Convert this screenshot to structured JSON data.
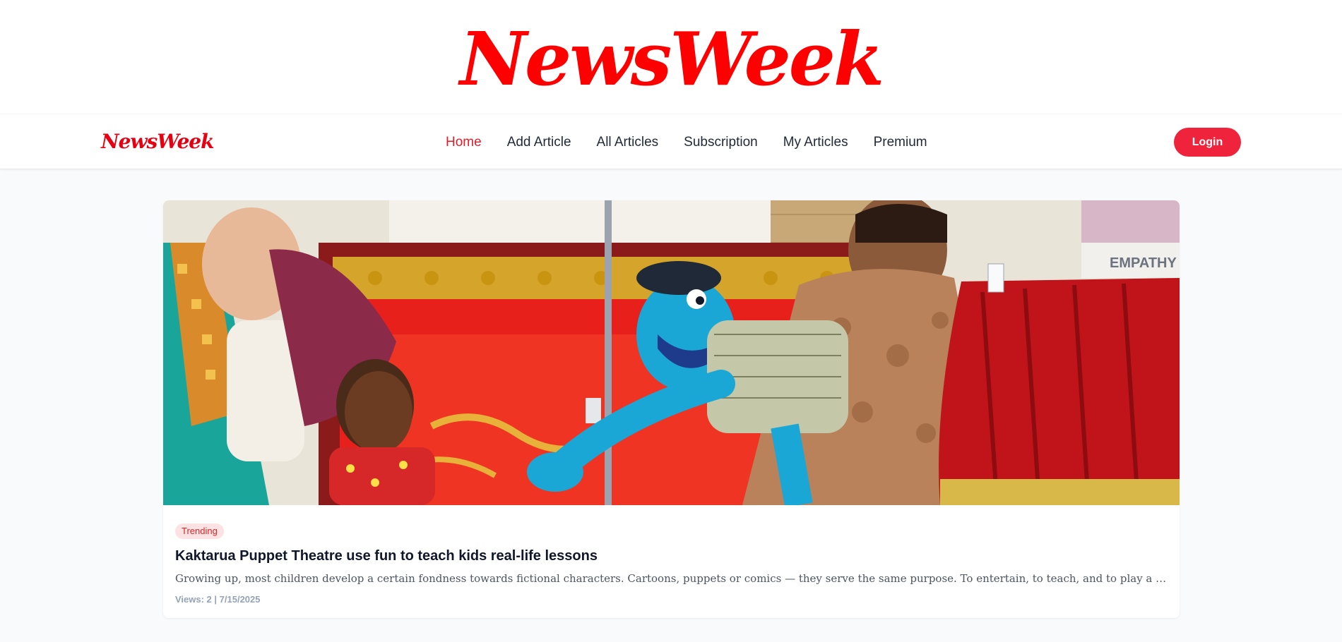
{
  "masthead": {
    "title": "NewsWeek"
  },
  "nav": {
    "logo": "NewsWeek",
    "links": [
      "Home",
      "Add Article",
      "All Articles",
      "Subscription",
      "My Articles",
      "Premium"
    ],
    "active": "Home",
    "login_label": "Login"
  },
  "article": {
    "badge": "Trending",
    "title": "Kaktarua Puppet Theatre use fun to teach kids real-life lessons",
    "excerpt": "Growing up, most children develop a certain fondness towards fictional characters. Cartoons, puppets or comics — they serve the same purpose. To entertain, to teach, and to play a vital role in the ps...",
    "meta": "Views: 2 | 7/15/2025",
    "image_sign_text": "EMPATHY"
  },
  "colors": {
    "brand": "#ff0000",
    "accent": "#ef233c",
    "badge_bg": "#fde2e4"
  }
}
